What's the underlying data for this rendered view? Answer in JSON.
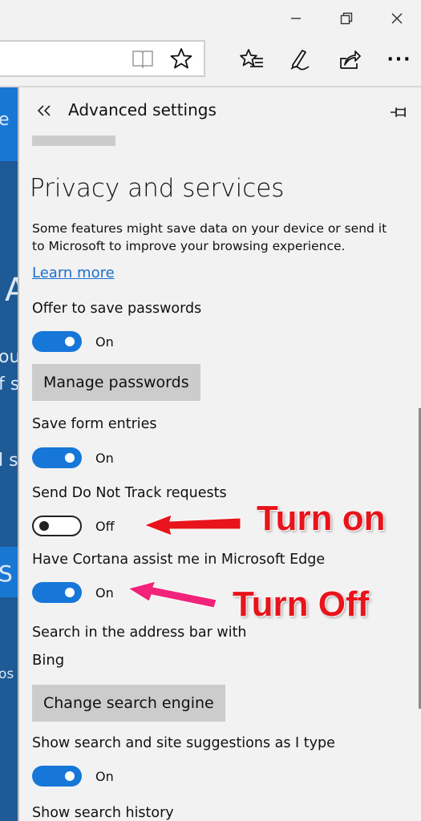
{
  "window": {
    "minimize_label": "—",
    "restore_label": "❐",
    "close_label": "✕"
  },
  "toolbar": {
    "icons": [
      "reading-view-icon",
      "favorites-icon",
      "hub-icon",
      "web-note-icon",
      "share-icon",
      "more-icon"
    ],
    "more_label": "···"
  },
  "panel": {
    "title": "Advanced settings",
    "section_title": "Privacy and services",
    "description": "Some features might save data on your device or send it to Microsoft to improve your browsing experience.",
    "learn_more": "Learn more",
    "settings": {
      "offer_passwords": {
        "label": "Offer to save passwords",
        "state": "On"
      },
      "manage_passwords_button": "Manage passwords",
      "save_form": {
        "label": "Save form entries",
        "state": "On"
      },
      "do_not_track": {
        "label": "Send Do Not Track requests",
        "state": "Off"
      },
      "cortana": {
        "label": "Have Cortana assist me in Microsoft Edge",
        "state": "On"
      },
      "search_label": "Search in the address bar with",
      "search_value": "Bing",
      "change_search_button": "Change search engine",
      "suggestions": {
        "label": "Show search and site suggestions as I type",
        "state": "On"
      },
      "history_label": "Show search history"
    }
  },
  "annotations": {
    "turn_on": "Turn on",
    "turn_off": "Turn Off",
    "color": "#e8141b"
  },
  "page_behind": {
    "fragments": [
      "e",
      "A",
      "ou",
      "f s",
      "l s",
      "S",
      "os"
    ]
  }
}
